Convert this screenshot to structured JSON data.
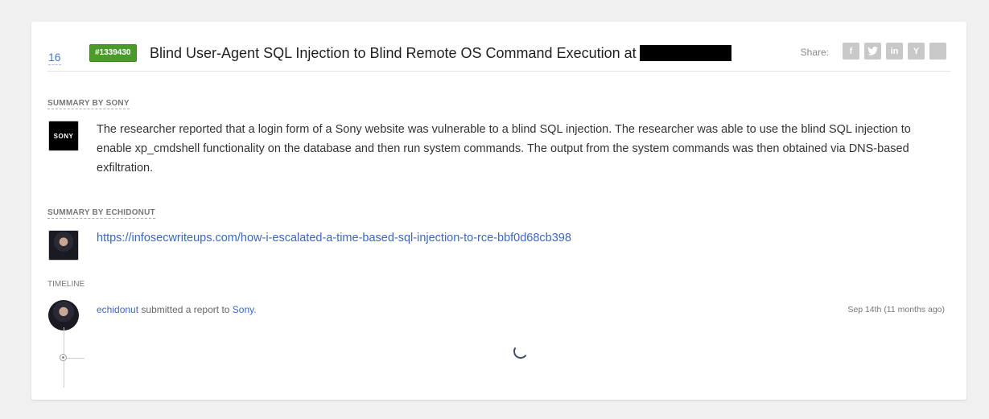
{
  "report": {
    "votes": "16",
    "id_badge": "#1339430",
    "title": "Blind User-Agent SQL Injection to Blind Remote OS Command Execution at"
  },
  "share": {
    "label": "Share:",
    "buttons": [
      {
        "icon": "facebook-icon",
        "glyph": "f"
      },
      {
        "icon": "twitter-icon",
        "glyph": "t"
      },
      {
        "icon": "linkedin-icon",
        "glyph": "in"
      },
      {
        "icon": "ycombinator-icon",
        "glyph": "Y"
      },
      {
        "icon": "reddit-icon",
        "glyph": ""
      }
    ]
  },
  "summary_sony": {
    "label": "SUMMARY BY SONY",
    "logo_text": "SONY",
    "text": "The researcher reported that a login form of a Sony website was vulnerable to a blind SQL injection. The researcher was able to use the blind SQL injection to enable xp_cmdshell functionality on the database and then run system commands. The output from the system commands was then obtained via DNS-based exfiltration."
  },
  "summary_reporter": {
    "label": "SUMMARY BY ECHIDONUT",
    "link": "https://infosecwriteups.com/how-i-escalated-a-time-based-sql-injection-to-rce-bbf0d68cb398"
  },
  "timeline": {
    "label": "TIMELINE",
    "entries": [
      {
        "user": "echidonut",
        "action": "submitted a report to",
        "program": "Sony.",
        "time": "Sep 14th (11 months ago)"
      }
    ]
  },
  "colors": {
    "badge": "#4b9b2c",
    "link": "#3b67c4",
    "background": "#f0f0f0"
  }
}
